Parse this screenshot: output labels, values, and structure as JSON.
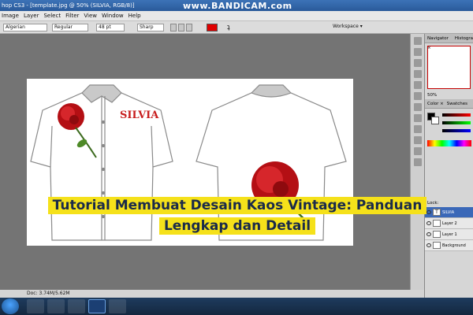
{
  "window": {
    "title": "hop CS3 - [template.jpg @ 50% (SILVIA, RGB/8)]"
  },
  "watermark": "www.BANDICAM.com",
  "menu": [
    "Image",
    "Layer",
    "Select",
    "Filter",
    "View",
    "Window",
    "Help"
  ],
  "options": {
    "font_family": "Algerian",
    "font_style": "Regular",
    "font_size": "48 pt",
    "antialias": "Sharp",
    "color": "#e00000",
    "workspace": "Workspace ▾"
  },
  "canvas": {
    "front_text": "SILVIA",
    "text_color": "#c81e1e"
  },
  "status": {
    "doc": "Doc: 3.74M/5.62M"
  },
  "panels": {
    "navigator_tabs": [
      "Navigator ×",
      "Histogra"
    ],
    "zoom": "50%",
    "color_tabs": [
      "Color ×",
      "Swatches"
    ],
    "layers_header": "Lock:",
    "layers": [
      {
        "name": "SILVIA",
        "active": true,
        "type": "T"
      },
      {
        "name": "Layer 2",
        "active": false,
        "type": ""
      },
      {
        "name": "Layer 1",
        "active": false,
        "type": ""
      },
      {
        "name": "Background",
        "active": false,
        "type": ""
      }
    ]
  },
  "banner": {
    "line1": "Tutorial Membuat Desain Kaos Vintage: Panduan",
    "line2": "Lengkap dan Detail"
  }
}
